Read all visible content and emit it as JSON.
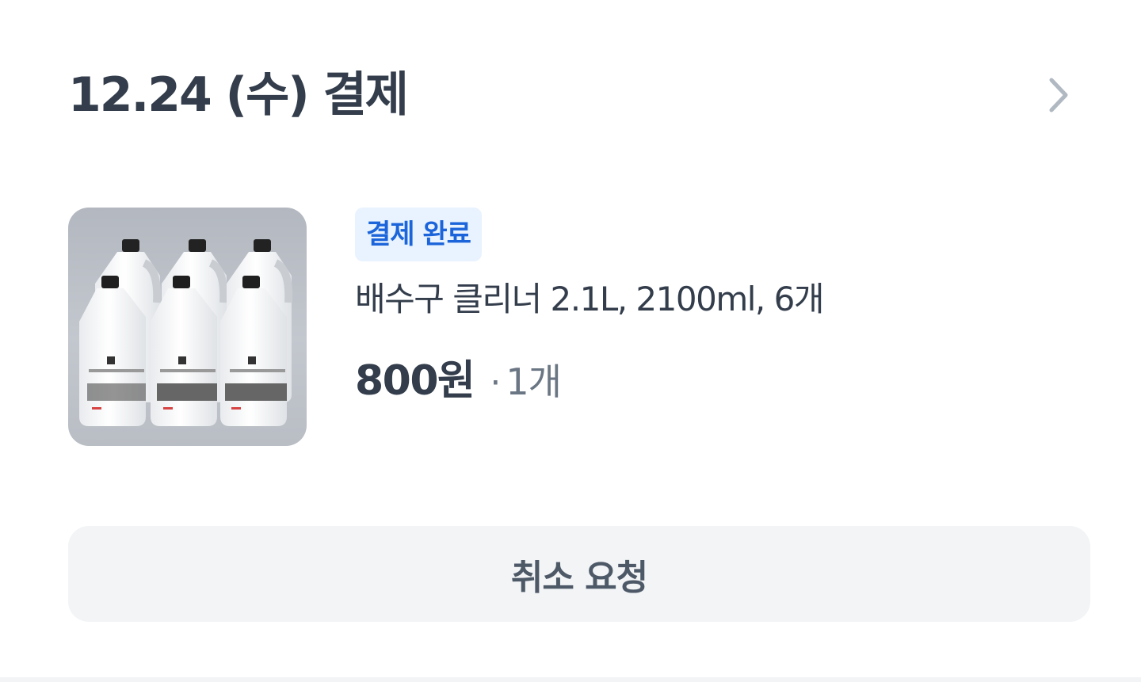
{
  "order": {
    "date_label": "12.24 (수) 결제",
    "detail_icon": "chevron-right-icon"
  },
  "item": {
    "image_icon": "cleaner-bottles-product-image",
    "status_badge": "결제 완료",
    "name": "배수구 클리너 2.1L, 2100ml, 6개",
    "price": "800원",
    "qty_separator": "·",
    "quantity": "1개"
  },
  "actions": {
    "cancel_label": "취소 요청"
  },
  "colors": {
    "text_primary": "#333d4b",
    "text_secondary": "#6b7684",
    "badge_bg": "#e8f3ff",
    "badge_text": "#1b64da",
    "button_bg": "#f2f4f6",
    "button_text": "#4e5968",
    "chevron": "#b0b8c1"
  }
}
